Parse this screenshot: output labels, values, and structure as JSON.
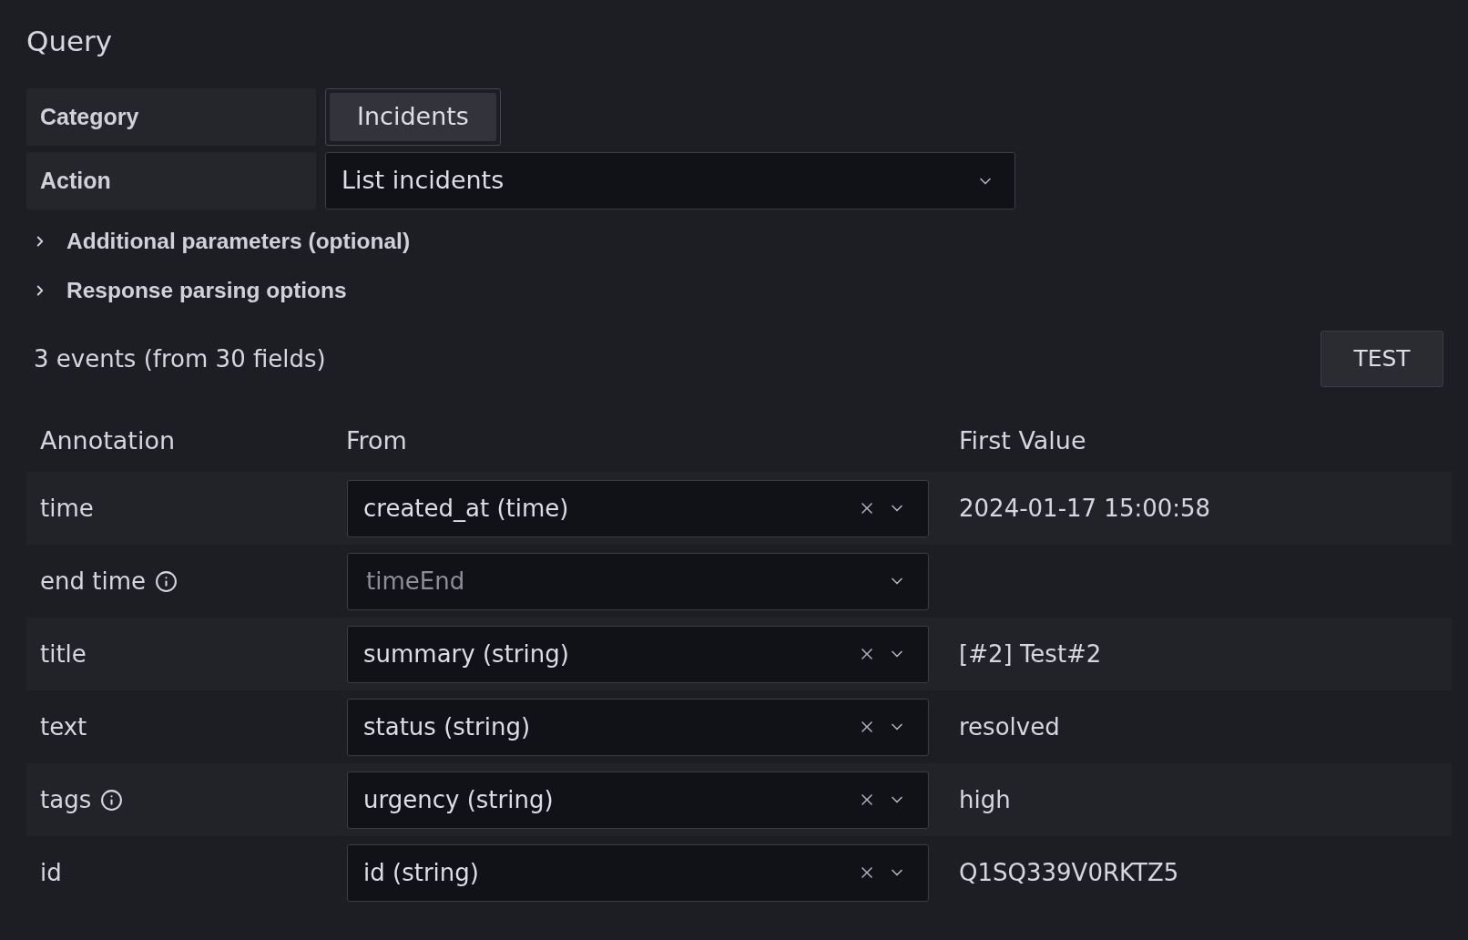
{
  "title": "Query",
  "fields": [
    {
      "kind": "radio-group",
      "label": "Category",
      "options": [
        {
          "label": "Incidents",
          "selected": true
        }
      ]
    },
    {
      "kind": "select",
      "label": "Action",
      "value": "List incidents"
    }
  ],
  "sections": [
    {
      "label": "Additional parameters (optional)",
      "expanded": false
    },
    {
      "label": "Response parsing options",
      "expanded": false
    }
  ],
  "summary": "3 events (from 30 fields)",
  "test_button": "TEST",
  "table": {
    "columns": [
      "Annotation",
      "From",
      "First Value"
    ],
    "rows": [
      {
        "annotation": "time",
        "info": false,
        "from": {
          "value": "created_at (time)"
        },
        "first_value": "2024-01-17 15:00:58"
      },
      {
        "annotation": "end time",
        "info": true,
        "from": {
          "placeholder": "timeEnd"
        }
      },
      {
        "annotation": "title",
        "info": false,
        "from": {
          "value": "summary (string)"
        },
        "first_value": "[#2] Test#2"
      },
      {
        "annotation": "text",
        "info": false,
        "from": {
          "value": "status (string)"
        },
        "first_value": "resolved"
      },
      {
        "annotation": "tags",
        "info": true,
        "from": {
          "value": "urgency (string)"
        },
        "first_value": "high"
      },
      {
        "annotation": "id",
        "info": false,
        "from": {
          "value": "id (string)"
        },
        "first_value": "Q1SQ339V0RKTZ5"
      }
    ]
  }
}
